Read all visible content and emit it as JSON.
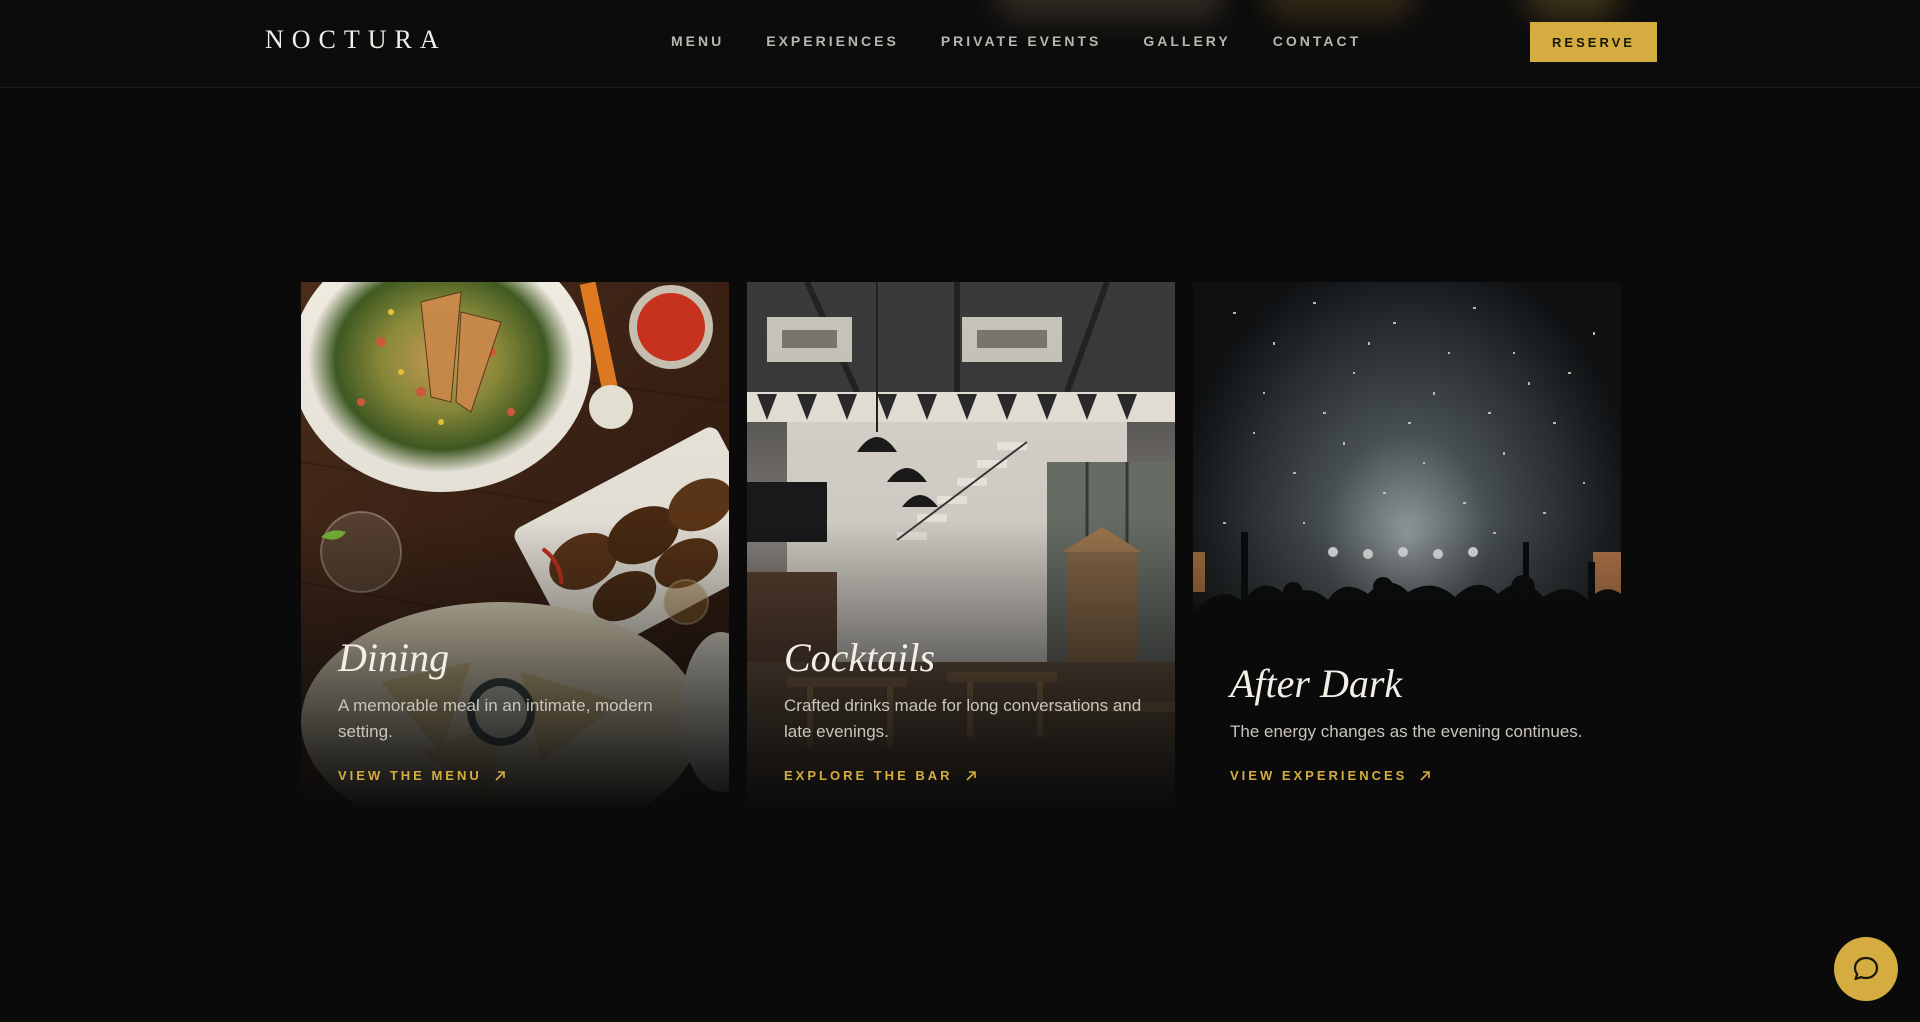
{
  "brand": {
    "logo": "NOCTURA"
  },
  "nav": {
    "items": [
      {
        "label": "MENU"
      },
      {
        "label": "EXPERIENCES"
      },
      {
        "label": "PRIVATE EVENTS"
      },
      {
        "label": "GALLERY"
      },
      {
        "label": "CONTACT"
      }
    ],
    "reserve_label": "RESERVE"
  },
  "cards": [
    {
      "title": "Dining",
      "description": "A memorable meal in an intimate, modern setting.",
      "link_label": "VIEW THE MENU",
      "link_icon": "arrow-up-right-icon"
    },
    {
      "title": "Cocktails",
      "description": "Crafted drinks made for long conversations and late evenings.",
      "link_label": "EXPLORE THE BAR",
      "link_icon": "arrow-up-right-icon"
    },
    {
      "title": "After Dark",
      "description": "The energy changes as the evening continues.",
      "link_label": "VIEW EXPERIENCES",
      "link_icon": "arrow-up-right-icon"
    }
  ],
  "chat": {
    "icon": "chat-bubble-icon"
  },
  "colors": {
    "accent": "#d4ac3f",
    "background": "#0a0a0a",
    "header_bg": "#0c0c0c",
    "text_primary": "#f3efe6",
    "text_muted": "#b9b6ae"
  }
}
